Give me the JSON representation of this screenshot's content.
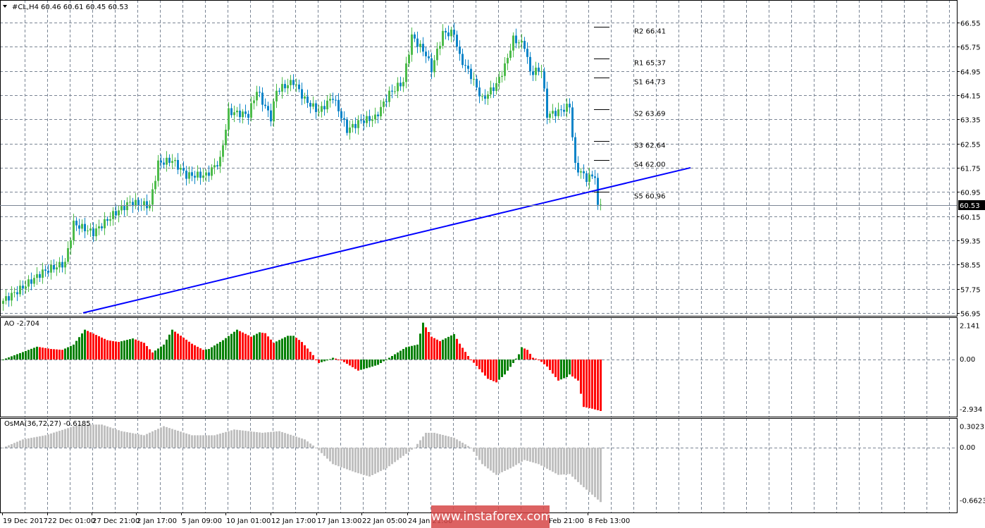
{
  "header": {
    "symbol": "#CL,H4",
    "ohlc": "60.46 60.61 60.45 60.53"
  },
  "chart_data": [
    {
      "type": "candlestick",
      "title": "#CL,H4",
      "ylim": [
        56.95,
        66.55
      ],
      "yticks": [
        "66.55",
        "65.75",
        "64.95",
        "64.15",
        "63.35",
        "62.55",
        "61.75",
        "60.95",
        "60.15",
        "59.35",
        "58.55",
        "57.75",
        "56.95"
      ],
      "current_price": "60.53",
      "xticks": [
        "19 Dec 2017",
        "22 Dec 01:00",
        "27 Dec 21:00",
        "2 Jan 17:00",
        "5 Jan 09:00",
        "10 Jan 01:00",
        "12 Jan 17:00",
        "17 Jan 13:00",
        "22 Jan 05:00",
        "24 Jan 21:00",
        "Feb 21:00",
        "8 Feb 13:00"
      ],
      "close_path_by_bar": [
        [
          0,
          57.35
        ],
        [
          7,
          57.8
        ],
        [
          14,
          58.3
        ],
        [
          22,
          58.6
        ],
        [
          25,
          59.9
        ],
        [
          32,
          59.6
        ],
        [
          39,
          60.2
        ],
        [
          45,
          60.6
        ],
        [
          52,
          60.5
        ],
        [
          55,
          61.9
        ],
        [
          60,
          62.0
        ],
        [
          65,
          61.5
        ],
        [
          72,
          61.5
        ],
        [
          77,
          62.0
        ],
        [
          80,
          63.6
        ],
        [
          87,
          63.5
        ],
        [
          90,
          64.3
        ],
        [
          95,
          63.4
        ],
        [
          97,
          64.3
        ],
        [
          103,
          64.6
        ],
        [
          107,
          64.0
        ],
        [
          112,
          63.6
        ],
        [
          117,
          64.1
        ],
        [
          122,
          63.0
        ],
        [
          127,
          63.3
        ],
        [
          132,
          63.4
        ],
        [
          137,
          64.2
        ],
        [
          142,
          64.6
        ],
        [
          145,
          66.1
        ],
        [
          150,
          65.5
        ],
        [
          152,
          65.0
        ],
        [
          156,
          66.2
        ],
        [
          160,
          66.2
        ],
        [
          162,
          65.4
        ],
        [
          166,
          64.8
        ],
        [
          170,
          64.0
        ],
        [
          175,
          64.5
        ],
        [
          178,
          65.1
        ],
        [
          181,
          66.0
        ],
        [
          185,
          65.8
        ],
        [
          187,
          64.9
        ],
        [
          191,
          65.0
        ],
        [
          193,
          63.5
        ],
        [
          197,
          63.6
        ],
        [
          201,
          63.8
        ],
        [
          203,
          61.8
        ],
        [
          207,
          61.4
        ],
        [
          210,
          61.5
        ],
        [
          211,
          60.4
        ],
        [
          212,
          60.53
        ]
      ],
      "pivots": [
        {
          "label": "R2 66.41",
          "value": 66.41
        },
        {
          "label": "R1 65.37",
          "value": 65.37
        },
        {
          "label": "S1 64.73",
          "value": 64.73
        },
        {
          "label": "S2 63.69",
          "value": 63.69
        },
        {
          "label": "S3 62.64",
          "value": 62.64
        },
        {
          "label": "S4 62.00",
          "value": 62.0
        },
        {
          "label": "S5 60.96",
          "value": 60.96
        }
      ],
      "trendline": {
        "from_bar": 28.5,
        "from_value": 56.95,
        "to_bar": 244,
        "to_value": 61.75,
        "color": "#0000ff"
      },
      "colors": {
        "up": "#4cbb4a",
        "down": "#0a84c8"
      }
    },
    {
      "type": "histogram",
      "title": "AO -2.704",
      "ylim": [
        -2.934,
        2.141
      ],
      "yticks": [
        "2.141",
        "0.00",
        "-2.934"
      ],
      "values_by_bar": [
        [
          0,
          0
        ],
        [
          12,
          0.73
        ],
        [
          17,
          0.6
        ],
        [
          21,
          0.55
        ],
        [
          25,
          0.85
        ],
        [
          29,
          1.7
        ],
        [
          37,
          1.1
        ],
        [
          41,
          1.0
        ],
        [
          46,
          1.2
        ],
        [
          50,
          0.95
        ],
        [
          53,
          0.4
        ],
        [
          57,
          0.85
        ],
        [
          60,
          1.7
        ],
        [
          67,
          0.9
        ],
        [
          71,
          0.55
        ],
        [
          73,
          0.6
        ],
        [
          78,
          1.1
        ],
        [
          83,
          1.7
        ],
        [
          88,
          1.3
        ],
        [
          91,
          1.55
        ],
        [
          93,
          1.5
        ],
        [
          96,
          0.95
        ],
        [
          101,
          1.35
        ],
        [
          103,
          1.35
        ],
        [
          106,
          1.0
        ],
        [
          110,
          0.25
        ],
        [
          111,
          0
        ],
        [
          112,
          -0.2
        ],
        [
          115,
          -0.05
        ],
        [
          117,
          0.1
        ],
        [
          120,
          -0.05
        ],
        [
          126,
          -0.63
        ],
        [
          130,
          -0.45
        ],
        [
          133,
          -0.3
        ],
        [
          136,
          0
        ],
        [
          138,
          0.2
        ],
        [
          143,
          0.7
        ],
        [
          147,
          0.85
        ],
        [
          149,
          2.1
        ],
        [
          152,
          1.3
        ],
        [
          155,
          1.05
        ],
        [
          160,
          1.45
        ],
        [
          162,
          0.9
        ],
        [
          165,
          0.2
        ],
        [
          166,
          0
        ],
        [
          172,
          -1.1
        ],
        [
          175,
          -1.3
        ],
        [
          178,
          -0.85
        ],
        [
          181,
          -0.2
        ],
        [
          183,
          0.3
        ],
        [
          184,
          0.7
        ],
        [
          186,
          0.55
        ],
        [
          188,
          0.1
        ],
        [
          190,
          0
        ],
        [
          193,
          -0.4
        ],
        [
          197,
          -1.2
        ],
        [
          200,
          -1.0
        ],
        [
          201,
          -0.85
        ],
        [
          204,
          -1.2
        ],
        [
          206,
          -2.7
        ],
        [
          209,
          -2.8
        ],
        [
          212,
          -2.93
        ]
      ],
      "colors": {
        "up": "#008000",
        "down": "#ff0000"
      }
    },
    {
      "type": "histogram",
      "title": "OsMA(36,72,27) -0.6185",
      "ylim": [
        -0.6623,
        0.3023
      ],
      "yticks": [
        "0.3023",
        "0.00",
        "-0.6623"
      ],
      "values_by_bar": [
        [
          0,
          0
        ],
        [
          7,
          0.1
        ],
        [
          15,
          0.15
        ],
        [
          27,
          0.28
        ],
        [
          35,
          0.28
        ],
        [
          42,
          0.2
        ],
        [
          50,
          0.15
        ],
        [
          57,
          0.26
        ],
        [
          67,
          0.15
        ],
        [
          75,
          0.15
        ],
        [
          82,
          0.22
        ],
        [
          92,
          0.18
        ],
        [
          98,
          0.2
        ],
        [
          107,
          0.1
        ],
        [
          111,
          0
        ],
        [
          117,
          -0.2
        ],
        [
          125,
          -0.3
        ],
        [
          130,
          -0.35
        ],
        [
          136,
          -0.25
        ],
        [
          142,
          -0.1
        ],
        [
          146,
          0
        ],
        [
          150,
          0.18
        ],
        [
          153,
          0.18
        ],
        [
          160,
          0.12
        ],
        [
          166,
          0
        ],
        [
          170,
          -0.2
        ],
        [
          175,
          -0.33
        ],
        [
          180,
          -0.25
        ],
        [
          185,
          -0.15
        ],
        [
          190,
          -0.2
        ],
        [
          197,
          -0.33
        ],
        [
          201,
          -0.32
        ],
        [
          205,
          -0.45
        ],
        [
          212,
          -0.66
        ]
      ],
      "color": "#c0c0c0"
    }
  ],
  "watermark": "www.instaforex.com"
}
